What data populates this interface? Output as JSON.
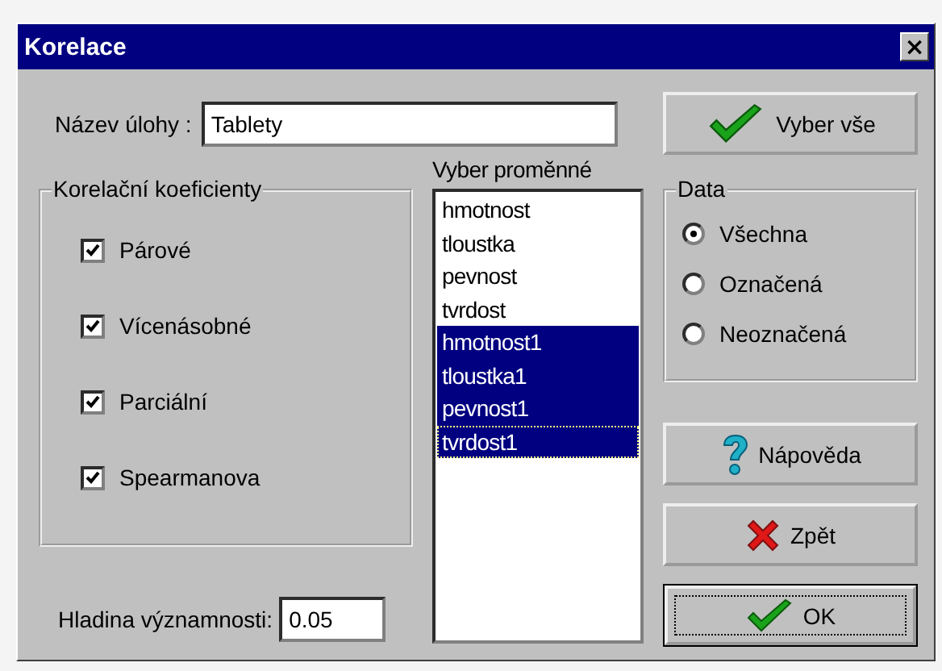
{
  "window": {
    "title": "Korelace",
    "close": "×"
  },
  "task_name": {
    "label": "Název úlohy :",
    "value": "Tablety"
  },
  "coefficients": {
    "title": "Korelační koeficienty",
    "items": [
      {
        "label": "Párové",
        "checked": true
      },
      {
        "label": "Vícenásobné",
        "checked": true
      },
      {
        "label": "Parciální",
        "checked": true
      },
      {
        "label": "Spearmanova",
        "checked": true
      }
    ]
  },
  "significance": {
    "label": "Hladina významnosti:",
    "value": "0.05"
  },
  "variables": {
    "title": "Vyber proměnné",
    "items": [
      {
        "label": "hmotnost",
        "selected": false
      },
      {
        "label": "tloustka",
        "selected": false
      },
      {
        "label": "pevnost",
        "selected": false
      },
      {
        "label": "tvrdost",
        "selected": false
      },
      {
        "label": "hmotnost1",
        "selected": true
      },
      {
        "label": "tloustka1",
        "selected": true
      },
      {
        "label": "pevnost1",
        "selected": true
      },
      {
        "label": "tvrdost1",
        "selected": true,
        "focused": true
      }
    ]
  },
  "data": {
    "title": "Data",
    "options": [
      {
        "label": "Všechna",
        "selected": true
      },
      {
        "label": "Označená",
        "selected": false
      },
      {
        "label": "Neoznačená",
        "selected": false
      }
    ]
  },
  "buttons": [
    {
      "label": "Vyber vše",
      "kind": "check",
      "default": false
    },
    {
      "label": "Nápověda",
      "kind": "help",
      "default": false
    },
    {
      "label": "Zpět",
      "kind": "cancel",
      "default": false
    },
    {
      "label": "OK",
      "kind": "check",
      "default": true
    }
  ]
}
